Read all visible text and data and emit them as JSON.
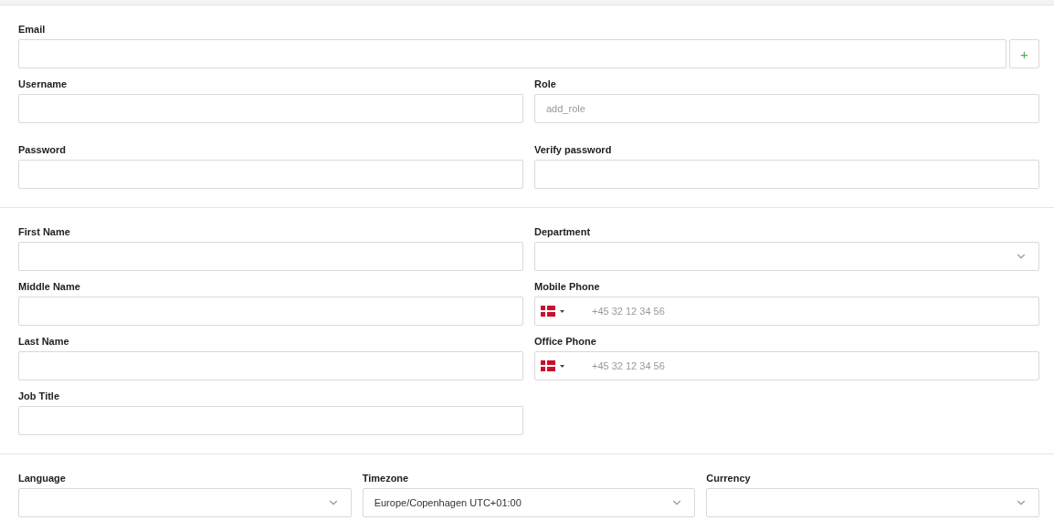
{
  "sections": [
    {
      "rows": [
        [
          {
            "kind": "text",
            "label": "Email",
            "add_button": "+"
          }
        ],
        [
          {
            "kind": "text",
            "label": "Username"
          },
          {
            "kind": "text",
            "label": "Role",
            "placeholder": "add_role"
          }
        ],
        [
          {
            "kind": "password",
            "label": "Password"
          },
          {
            "kind": "password",
            "label": "Verify password"
          }
        ]
      ]
    },
    {
      "rows": [
        [
          {
            "kind": "text",
            "label": "First Name"
          },
          {
            "kind": "select",
            "label": "Department"
          }
        ],
        [
          {
            "kind": "text",
            "label": "Middle Name"
          },
          {
            "kind": "phone",
            "label": "Mobile Phone",
            "placeholder": "+45 32 12 34 56"
          }
        ],
        [
          {
            "kind": "text",
            "label": "Last Name"
          },
          {
            "kind": "phone",
            "label": "Office Phone",
            "placeholder": "+45 32 12 34 56"
          }
        ],
        [
          {
            "kind": "text",
            "label": "Job Title"
          }
        ]
      ]
    },
    {
      "rows": [
        [
          {
            "kind": "select",
            "label": "Language"
          },
          {
            "kind": "select",
            "label": "Timezone",
            "value": "Europe/Copenhagen UTC+01:00"
          },
          {
            "kind": "select",
            "label": "Currency"
          }
        ]
      ]
    }
  ]
}
